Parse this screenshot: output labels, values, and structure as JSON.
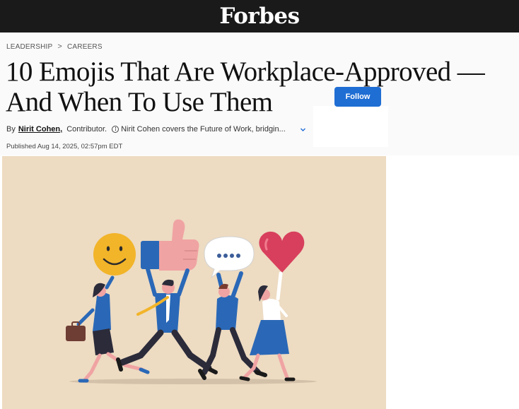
{
  "header": {
    "logo_text": "Forbes"
  },
  "breadcrumb": {
    "items": [
      "LEADERSHIP",
      "CAREERS"
    ],
    "separator": ">"
  },
  "article": {
    "title": "10 Emojis That Are Workplace-Approved — And When To Use Them",
    "byline": {
      "prefix": "By",
      "author": "Nirit Cohen,",
      "role": "Contributor.",
      "bio_snippet": "Nirit Cohen covers the Future of Work, bridgin..."
    },
    "follow_label": "Follow",
    "published": "Published Aug 14, 2025, 02:57pm EDT"
  },
  "hero_image": {
    "background_color": "#eddbc2"
  },
  "colors": {
    "topbar": "#1a1a1a",
    "accent": "#1f6ed4"
  },
  "icons": [
    "chevron-right-icon",
    "info-icon",
    "chevron-down-icon"
  ]
}
